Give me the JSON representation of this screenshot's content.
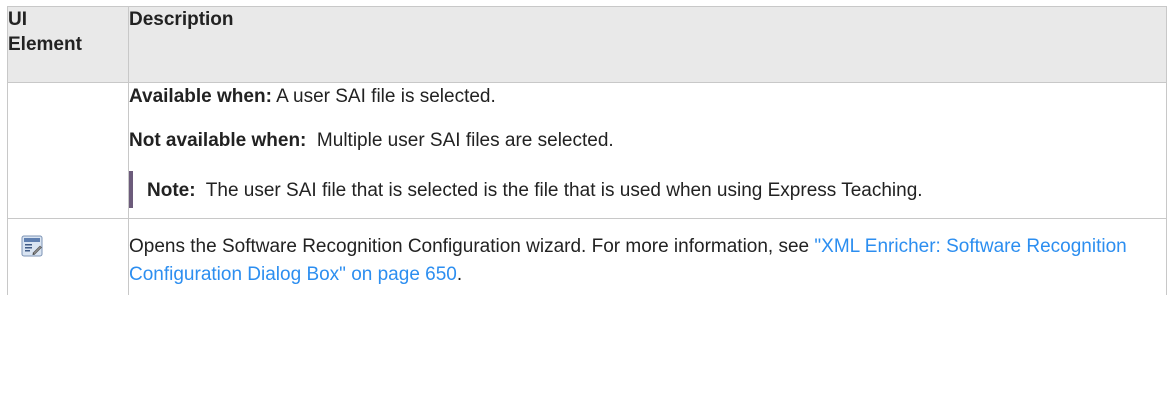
{
  "table": {
    "headers": {
      "ui_element_line1": "UI",
      "ui_element_line2": "Element",
      "description": "Description"
    },
    "rows": [
      {
        "ui_element": "",
        "available_label": "Available when:",
        "available_text": " A user SAI file is selected.",
        "not_available_label": "Not available when:",
        "not_available_text": "  Multiple user SAI files are selected.",
        "note_label": "Note:",
        "note_text": "  The user SAI file that is selected is the file that is used when using Express Teaching."
      },
      {
        "ui_element_icon": "software-recognition-wizard-icon",
        "description_text": "Opens the Software Recognition Configuration wizard. For more information, see ",
        "link_text": "\"XML Enricher: Software Recognition Configuration Dialog Box\" on page 650",
        "description_end": "."
      }
    ]
  },
  "colors": {
    "header_bg": "#e9e9e9",
    "border": "#c8c8c8",
    "link": "#2c8ef0",
    "note_bar": "#6c5b7b"
  }
}
